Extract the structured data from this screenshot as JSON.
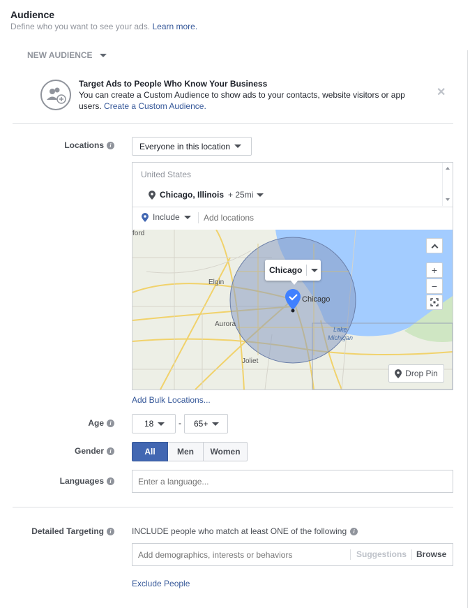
{
  "header": {
    "title": "Audience",
    "subtitle": "Define who you want to see your ads.",
    "learn_more": "Learn more."
  },
  "audience_dropdown": "NEW AUDIENCE",
  "notice": {
    "title": "Target Ads to People Who Know Your Business",
    "body": "You can create a Custom Audience to show ads to your contacts, website visitors or app users.",
    "link": "Create a Custom Audience."
  },
  "locations": {
    "label": "Locations",
    "type_select": "Everyone in this location",
    "country": "United States",
    "selected_city": "Chicago, Illinois",
    "radius": "+ 25mi",
    "include_select": "Include",
    "add_placeholder": "Add locations",
    "bulk_link": "Add Bulk Locations..."
  },
  "map": {
    "city_popup": "Chicago",
    "drop_pin": "Drop Pin",
    "labels": {
      "ford": "ford",
      "elgin": "Elgin",
      "aurora": "Aurora",
      "joliet": "Joliet",
      "chicago": "Chicago",
      "lake": "Lake",
      "michigan": "Michigan"
    }
  },
  "age": {
    "label": "Age",
    "min": "18",
    "max": "65+",
    "separator": "-"
  },
  "gender": {
    "label": "Gender",
    "options": [
      "All",
      "Men",
      "Women"
    ],
    "selected": "All"
  },
  "languages": {
    "label": "Languages",
    "placeholder": "Enter a language..."
  },
  "detailed_targeting": {
    "label": "Detailed Targeting",
    "include_text": "INCLUDE people who match at least ONE of the following",
    "placeholder": "Add demographics, interests or behaviors",
    "suggestions": "Suggestions",
    "browse": "Browse",
    "exclude_link": "Exclude People"
  },
  "colors": {
    "link": "#365899",
    "accent": "#4267b2",
    "radius_fill": "#8b9dc3",
    "water": "#a3ccff"
  }
}
